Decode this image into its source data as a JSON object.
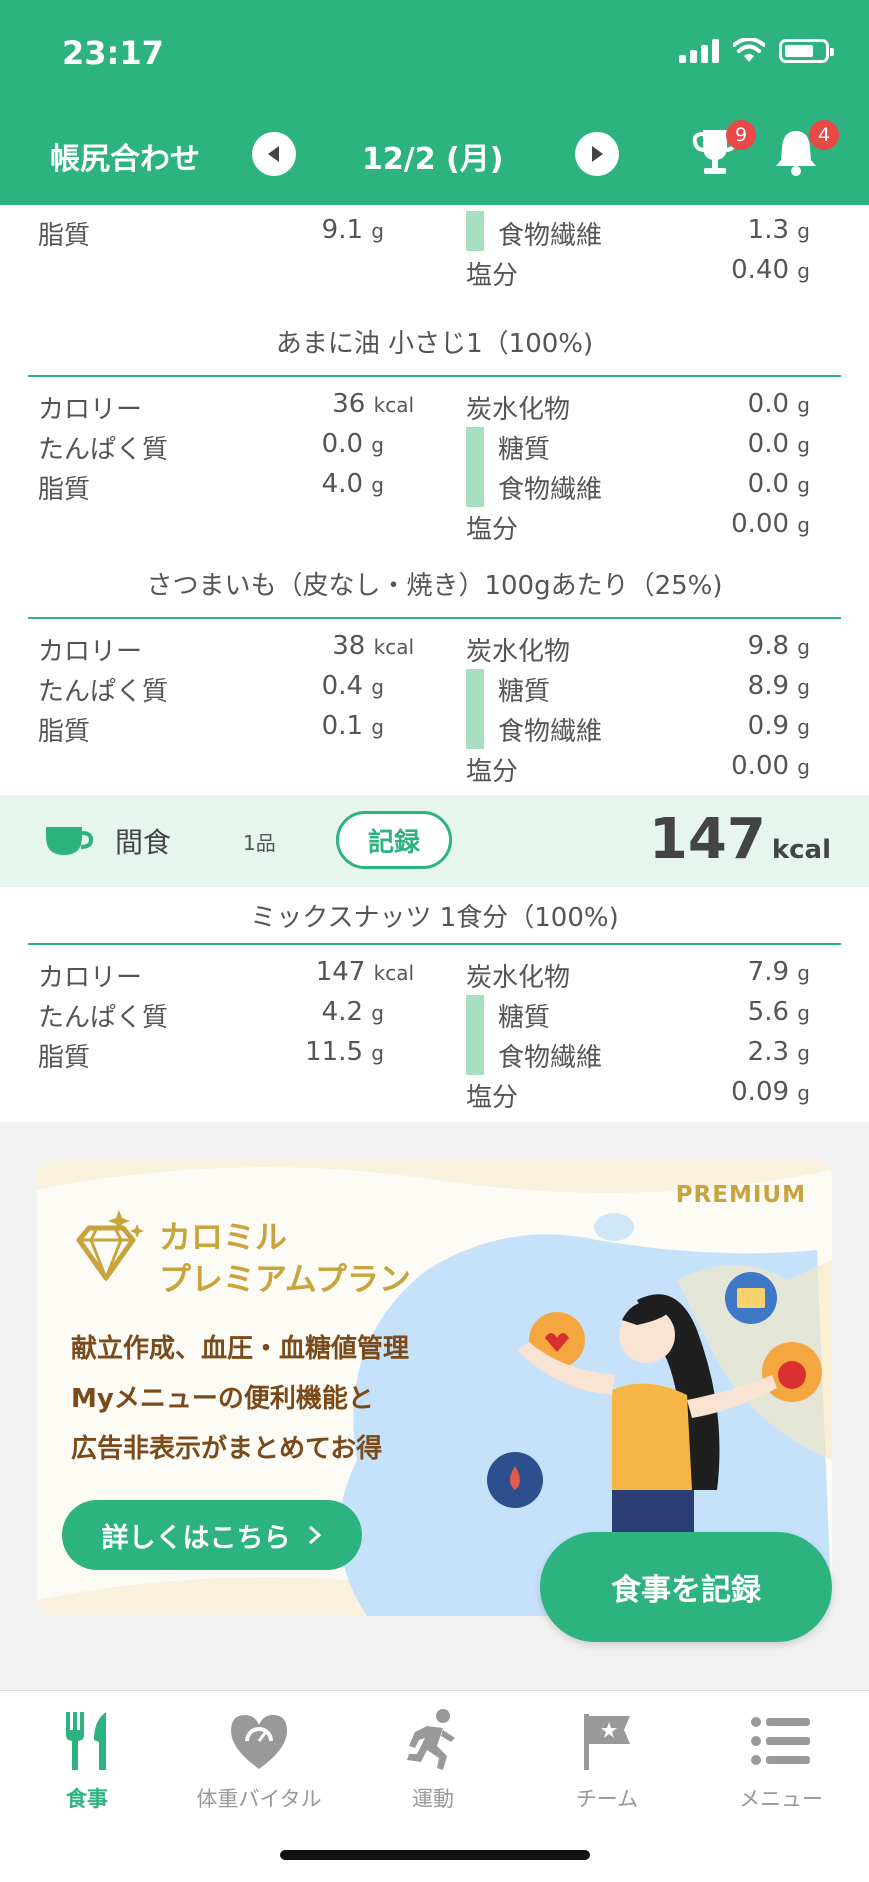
{
  "status": {
    "time": "23:17"
  },
  "header": {
    "title": "帳尻合わせ",
    "date": "12/2 (月)",
    "trophy_badge": "9",
    "bell_badge": "4"
  },
  "partial_item": {
    "fat_label": "脂質",
    "fat_value": "9.1",
    "fat_unit": "g",
    "fiber_label": "食物繊維",
    "fiber_value": "1.3",
    "fiber_unit": "g",
    "salt_label": "塩分",
    "salt_value": "0.40",
    "salt_unit": "g"
  },
  "foods": [
    {
      "title": "あまに油 小さじ1（100%)",
      "calorie_label": "カロリー",
      "calorie_value": "36",
      "calorie_unit": "kcal",
      "protein_label": "たんぱく質",
      "protein_value": "0.0",
      "protein_unit": "g",
      "fat_label": "脂質",
      "fat_value": "4.0",
      "fat_unit": "g",
      "carb_label": "炭水化物",
      "carb_value": "0.0",
      "carb_unit": "g",
      "sugar_label": "糖質",
      "sugar_value": "0.0",
      "sugar_unit": "g",
      "fiber_label": "食物繊維",
      "fiber_value": "0.0",
      "fiber_unit": "g",
      "salt_label": "塩分",
      "salt_value": "0.00",
      "salt_unit": "g"
    },
    {
      "title": "さつまいも（皮なし・焼き）100gあたり（25%)",
      "calorie_label": "カロリー",
      "calorie_value": "38",
      "calorie_unit": "kcal",
      "protein_label": "たんぱく質",
      "protein_value": "0.4",
      "protein_unit": "g",
      "fat_label": "脂質",
      "fat_value": "0.1",
      "fat_unit": "g",
      "carb_label": "炭水化物",
      "carb_value": "9.8",
      "carb_unit": "g",
      "sugar_label": "糖質",
      "sugar_value": "8.9",
      "sugar_unit": "g",
      "fiber_label": "食物繊維",
      "fiber_value": "0.9",
      "fiber_unit": "g",
      "salt_label": "塩分",
      "salt_value": "0.00",
      "salt_unit": "g"
    },
    {
      "title": "ミックスナッツ 1食分（100%)",
      "calorie_label": "カロリー",
      "calorie_value": "147",
      "calorie_unit": "kcal",
      "protein_label": "たんぱく質",
      "protein_value": "4.2",
      "protein_unit": "g",
      "fat_label": "脂質",
      "fat_value": "11.5",
      "fat_unit": "g",
      "carb_label": "炭水化物",
      "carb_value": "7.9",
      "carb_unit": "g",
      "sugar_label": "糖質",
      "sugar_value": "5.6",
      "sugar_unit": "g",
      "fiber_label": "食物繊維",
      "fiber_value": "2.3",
      "fiber_unit": "g",
      "salt_label": "塩分",
      "salt_value": "0.09",
      "salt_unit": "g"
    }
  ],
  "snack": {
    "label": "間食",
    "count": "1品",
    "record_button": "記録",
    "kcal_value": "147",
    "kcal_unit": "kcal"
  },
  "premium": {
    "tag": "PREMIUM",
    "title_line1": "カロミル",
    "title_line2": "プレミアムプラン",
    "desc_line1": "献立作成、血圧・血糖値管理",
    "desc_line2": "Myメニューの便利機能と",
    "desc_line3": "広告非表示がまとめてお得",
    "detail_button": "詳しくはこちら"
  },
  "fab_label": "食事を記録",
  "tabs": [
    {
      "label": "食事",
      "icon": "fork-knife-icon"
    },
    {
      "label": "体重バイタル",
      "icon": "heart-scale-icon"
    },
    {
      "label": "運動",
      "icon": "runner-icon"
    },
    {
      "label": "チーム",
      "icon": "flag-icon"
    },
    {
      "label": "メニュー",
      "icon": "list-icon"
    }
  ],
  "colors": {
    "accent": "#2db37f",
    "premium_gold": "#c9a43c",
    "badge_red": "#e84848"
  }
}
